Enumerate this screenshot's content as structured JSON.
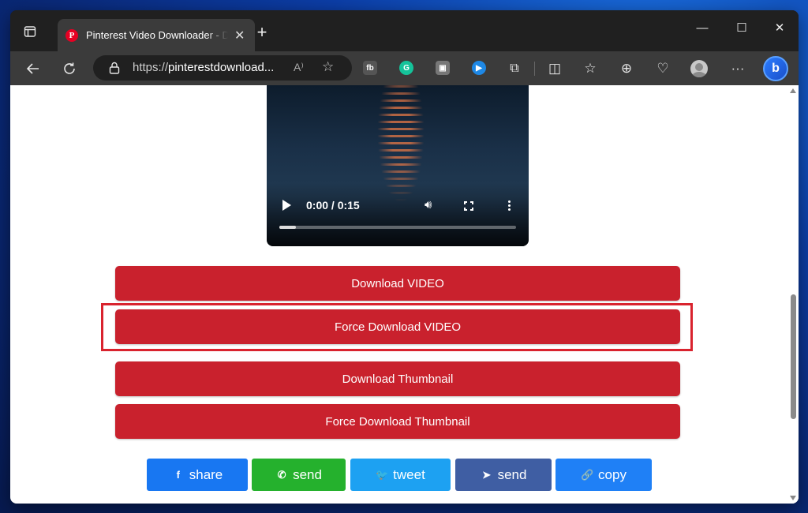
{
  "browser": {
    "tab_title": "Pinterest Video Downloader - Do",
    "favicon_letter": "P",
    "url_scheme": "https://",
    "url_host": "pinterestdownload..."
  },
  "video": {
    "time": "0:00 / 0:15",
    "progress": 0.07
  },
  "buttons": {
    "download_video": "Download VIDEO",
    "force_download_video": "Force Download VIDEO",
    "download_thumbnail": "Download Thumbnail",
    "force_download_thumbnail": "Force Download Thumbnail"
  },
  "share": [
    {
      "label": "share",
      "icon": "facebook-icon",
      "glyph": "f",
      "color": "#1877f2"
    },
    {
      "label": "send",
      "icon": "whatsapp-icon",
      "glyph": "✆",
      "color": "#25b12d"
    },
    {
      "label": "tweet",
      "icon": "twitter-icon",
      "glyph": "🐦",
      "color": "#1da1f2"
    },
    {
      "label": "send",
      "icon": "telegram-icon",
      "glyph": "➤",
      "color": "#3f5ea3"
    },
    {
      "label": "copy",
      "icon": "link-icon",
      "glyph": "🔗",
      "color": "#1f80f6"
    }
  ],
  "colors": {
    "button_red": "#c9212d",
    "highlight_red": "#d9232e"
  }
}
